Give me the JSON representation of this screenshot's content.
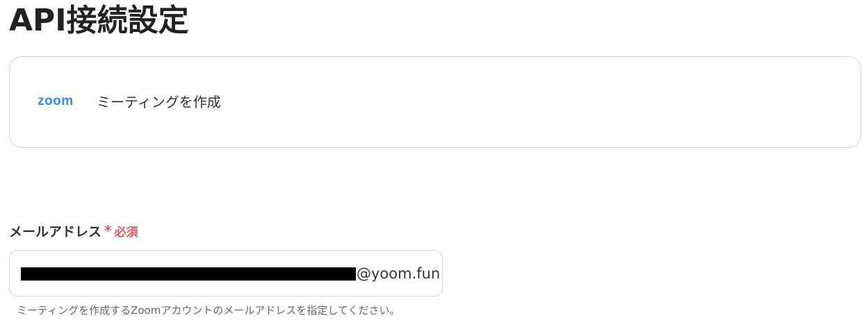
{
  "page": {
    "title": "API接続設定"
  },
  "action_card": {
    "app_logo_text": "zoom",
    "action_label": "ミーティングを作成",
    "app_icon": "zoom-logo-icon",
    "brand_color": "#2d8cff"
  },
  "email_field": {
    "label": "メールアドレス",
    "required_marker": "*",
    "required_text": "必須",
    "value_visible_domain": "@yoom.fun",
    "value_redacted": true,
    "help_text": "ミーティングを作成するZoomアカウントのメールアドレスを指定してください。",
    "required_color": "#e05a63"
  }
}
